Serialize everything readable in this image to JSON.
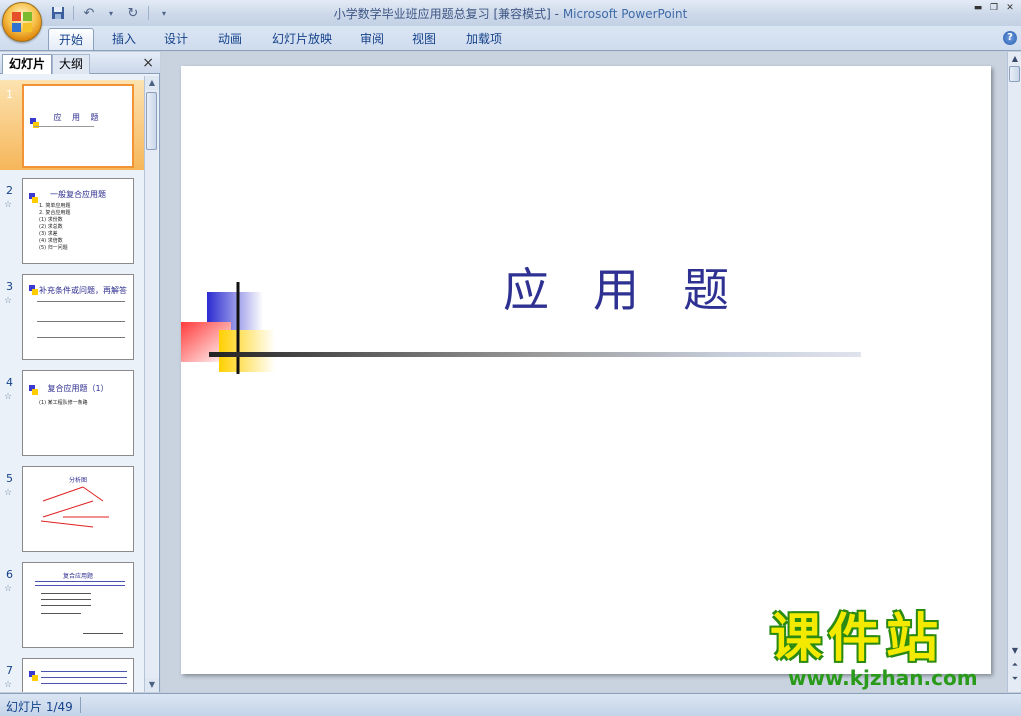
{
  "window": {
    "title": "小学数学毕业班应用题总复习 [兼容模式] - ",
    "app_name": "Microsoft PowerPoint"
  },
  "quick_access": {
    "save_icon": "save-icon",
    "undo_icon": "undo-icon",
    "redo_icon": "redo-icon",
    "customize_icon": "dropdown-icon"
  },
  "ribbon": {
    "tabs": [
      "开始",
      "插入",
      "设计",
      "动画",
      "幻灯片放映",
      "审阅",
      "视图",
      "加载项"
    ],
    "active_tab": "开始",
    "help_label": "?"
  },
  "left_panel": {
    "tab_slides": "幻灯片",
    "tab_outline": "大纲",
    "close_label": "×",
    "slides": [
      {
        "num": "1",
        "title": "应 用 题",
        "selected": true
      },
      {
        "num": "2",
        "title": "一般复合应用题",
        "lines": [
          "1. 简单应用题",
          "2. 复合应用题",
          "(1) 求份数",
          "(2) 求总数",
          "(3) 求差",
          "(4) 求倍数",
          "(5) 归一问题"
        ]
      },
      {
        "num": "3",
        "title": "补充条件或问题，再解答"
      },
      {
        "num": "4",
        "title": "复合应用题（1）",
        "lines": [
          "(1) 某工程队修一条路"
        ]
      },
      {
        "num": "5",
        "title": "分析图"
      },
      {
        "num": "6",
        "title": "复合应用题"
      },
      {
        "num": "7",
        "title": ""
      }
    ],
    "anim_marker": "☆"
  },
  "slide": {
    "title": "应用题"
  },
  "watermark": {
    "brand": "课件站",
    "url": "www.kjzhan.com"
  },
  "status_bar": {
    "slide_counter": "幻灯片 1/49"
  },
  "colors": {
    "title_blue": "#2e3192",
    "accent_orange": "#f6b65a",
    "ribbon_text": "#15428b"
  }
}
